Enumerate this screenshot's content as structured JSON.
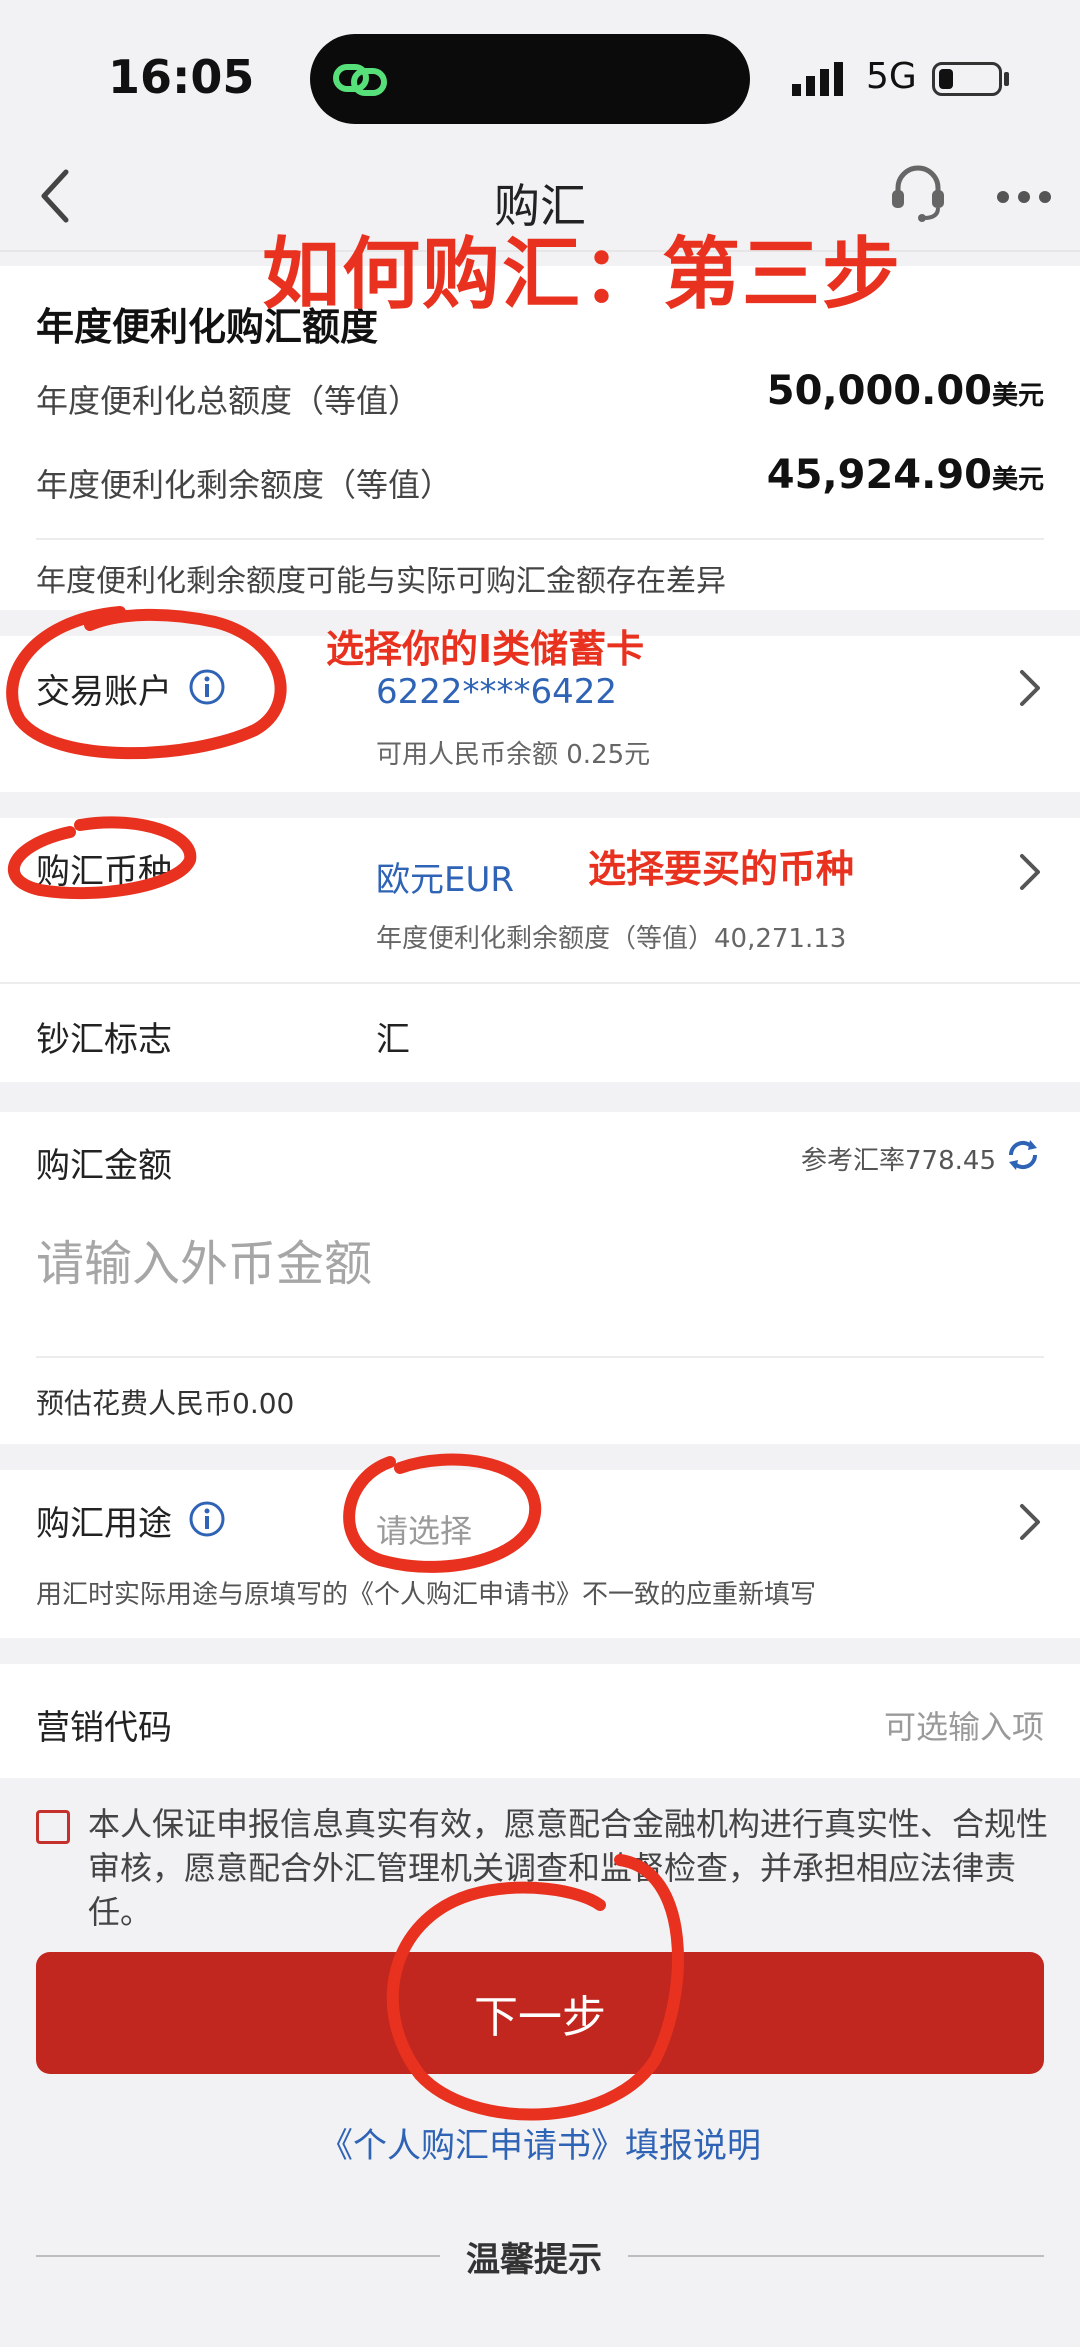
{
  "status_bar": {
    "time": "16:05",
    "network": "5G"
  },
  "nav": {
    "title": "购汇"
  },
  "quota": {
    "heading": "年度便利化购汇额度",
    "total_label": "年度便利化总额度（等值）",
    "total_value": "50,000.00",
    "remaining_label": "年度便利化剩余额度（等值）",
    "remaining_value": "45,924.90",
    "unit": "美元",
    "note": "年度便利化剩余额度可能与实际可购汇金额存在差异"
  },
  "account": {
    "label": "交易账户",
    "value": "6222****6422",
    "balance": "可用人民币余额 0.25元"
  },
  "currency": {
    "label": "购汇币种",
    "value": "欧元EUR",
    "sub": "年度便利化剩余额度（等值）40,271.13"
  },
  "cash_flag": {
    "label": "钞汇标志",
    "value": "汇"
  },
  "amount": {
    "label": "购汇金额",
    "rate": "参考汇率778.45",
    "placeholder": "请输入外币金额",
    "estimate": "预估花费人民币0.00"
  },
  "purpose": {
    "label": "购汇用途",
    "placeholder": "请选择",
    "note": "用汇时实际用途与原填写的《个人购汇申请书》不一致的应重新填写"
  },
  "marketing": {
    "label": "营销代码",
    "placeholder": "可选输入项"
  },
  "declaration": "本人保证申报信息真实有效，愿意配合金融机构进行真实性、合规性审核，愿意配合外汇管理机关调查和监督检查，并承担相应法律责任。",
  "next_button": "下一步",
  "link": "《个人购汇申请书》填报说明",
  "tips_heading": "温馨提示",
  "annotations": {
    "main": "如何购汇：第三步",
    "account_hint": "选择你的I类储蓄卡",
    "currency_hint": "选择要买的币种"
  },
  "colors": {
    "brand_red": "#c1271f",
    "link_blue": "#2f63b5",
    "annotation_red": "#e8321f"
  }
}
